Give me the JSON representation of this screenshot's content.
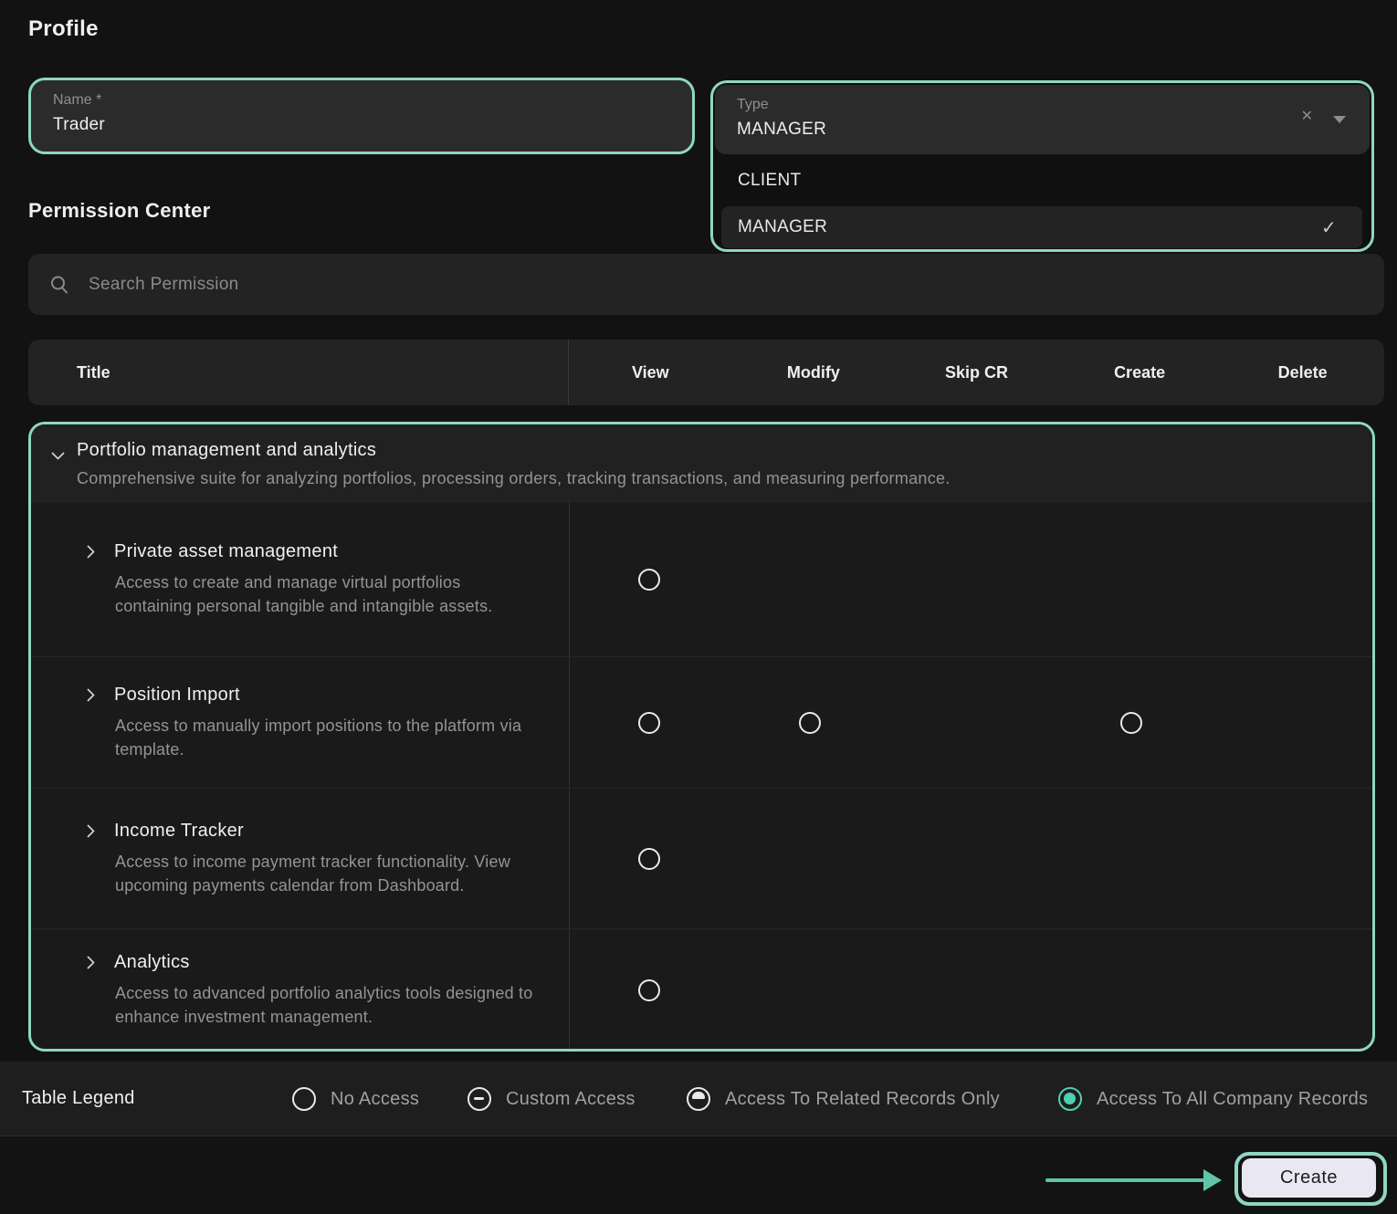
{
  "profile": {
    "heading": "Profile",
    "name": {
      "label": "Name *",
      "value": "Trader"
    },
    "type": {
      "label": "Type",
      "value": "MANAGER",
      "options": [
        {
          "label": "CLIENT",
          "selected": false
        },
        {
          "label": "MANAGER",
          "selected": true
        }
      ]
    }
  },
  "permission_center": {
    "heading": "Permission Center",
    "search_placeholder": "Search Permission",
    "columns": [
      "Title",
      "View",
      "Modify",
      "Skip CR",
      "Create",
      "Delete"
    ],
    "group": {
      "title": "Portfolio management and analytics",
      "description": "Comprehensive suite for analyzing portfolios, processing orders, tracking transactions, and measuring performance.",
      "rows": [
        {
          "title": "Private asset management",
          "description": "Access to create and manage virtual portfolios containing personal tangible and intangible assets.",
          "radios": [
            "View"
          ]
        },
        {
          "title": "Position Import",
          "description": "Access to manually import positions to the platform via template.",
          "radios": [
            "View",
            "Modify",
            "Create"
          ]
        },
        {
          "title": "Income Tracker",
          "description": "Access to income payment tracker functionality. View upcoming payments calendar from Dashboard.",
          "radios": [
            "View"
          ]
        },
        {
          "title": "Analytics",
          "description": "Access to advanced portfolio analytics tools designed to enhance investment management.",
          "radios": [
            "View"
          ]
        }
      ]
    }
  },
  "legend": {
    "title": "Table Legend",
    "items": [
      {
        "label": "No Access",
        "icon": "empty-circle",
        "selected": false
      },
      {
        "label": "Custom Access",
        "icon": "dash-circle",
        "selected": false
      },
      {
        "label": "Access To Related Records Only",
        "icon": "half-filled-circle",
        "selected": false
      },
      {
        "label": "Access To All Company Records",
        "icon": "filled-circle",
        "selected": true
      }
    ]
  },
  "footer": {
    "create_label": "Create"
  },
  "icons": {
    "clear": "✕",
    "check": "✓"
  },
  "colors": {
    "annotation_teal": "#8fd6c4",
    "selected_radio_teal": "#4fd0b2",
    "arrow_teal": "#5fc5a9",
    "create_button_bg": "#e9e8f2",
    "page_bg": "#121212"
  }
}
